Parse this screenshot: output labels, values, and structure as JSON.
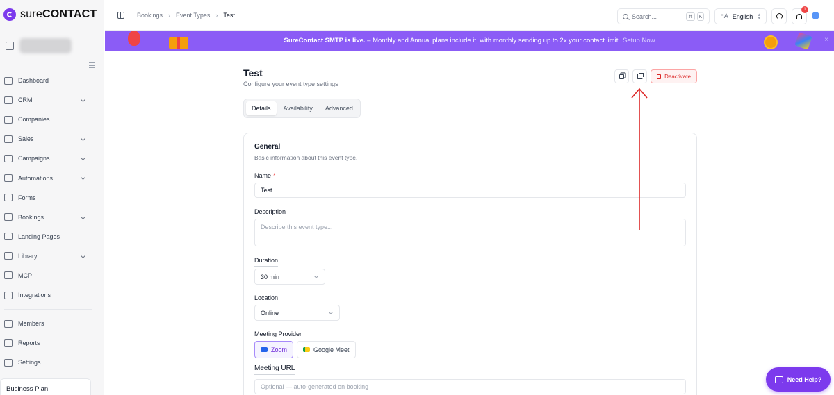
{
  "app": {
    "logo_text": "sureCONTACT",
    "logo_prefix": "sure",
    "logo_suffix": "CONTACT",
    "accent": "#7c3aed"
  },
  "sidebar": {
    "items": [
      {
        "label": "Dashboard",
        "icon": "dashboard-icon",
        "has_chevron": false
      },
      {
        "label": "CRM",
        "icon": "crm-icon",
        "has_chevron": true
      },
      {
        "label": "Companies",
        "icon": "companies-icon",
        "has_chevron": false
      },
      {
        "label": "Sales",
        "icon": "sales-icon",
        "has_chevron": true
      },
      {
        "label": "Campaigns",
        "icon": "megaphone-icon",
        "has_chevron": true
      },
      {
        "label": "Automations",
        "icon": "automations-icon",
        "has_chevron": true
      },
      {
        "label": "Forms",
        "icon": "forms-icon",
        "has_chevron": false
      },
      {
        "label": "Bookings",
        "icon": "calendar-icon",
        "has_chevron": true
      },
      {
        "label": "Landing Pages",
        "icon": "landing-pages-icon",
        "has_chevron": false
      },
      {
        "label": "Library",
        "icon": "library-icon",
        "has_chevron": true
      },
      {
        "label": "MCP",
        "icon": "mcp-icon",
        "has_chevron": false
      },
      {
        "label": "Integrations",
        "icon": "integrations-icon",
        "has_chevron": false
      }
    ],
    "bottom_items": [
      {
        "label": "Members",
        "icon": "members-icon"
      },
      {
        "label": "Reports",
        "icon": "reports-icon"
      },
      {
        "label": "Settings",
        "icon": "settings-icon"
      }
    ],
    "plan": "Business Plan"
  },
  "topbar": {
    "breadcrumb": [
      "Bookings",
      "Event Types",
      "Test"
    ],
    "search_placeholder": "Search...",
    "kbd_cmd": "⌘",
    "kbd_key": "K",
    "language": "English",
    "notification_count": "1"
  },
  "banner": {
    "bold": "SureContact SMTP is live.",
    "text": " – Monthly and Annual plans include it, with monthly sending up to 2x your contact limit.",
    "link": "Setup Now",
    "color": "#8b5cf6"
  },
  "page": {
    "title": "Test",
    "subtitle": "Configure your event type settings",
    "deactivate_label": "Deactivate",
    "tabs": [
      "Details",
      "Availability",
      "Advanced"
    ],
    "active_tab": "Details"
  },
  "form": {
    "section_title": "General",
    "section_desc": "Basic information about this event type.",
    "name_label": "Name",
    "name_required": "*",
    "name_value": "Test",
    "description_label": "Description",
    "description_placeholder": "Describe this event type...",
    "duration_label": "Duration",
    "duration_value": "30 min",
    "location_label": "Location",
    "location_value": "Online",
    "provider_label": "Meeting Provider",
    "providers": [
      {
        "label": "Zoom",
        "icon": "zoom-icon",
        "selected": true
      },
      {
        "label": "Google Meet",
        "icon": "google-meet-icon",
        "selected": false
      }
    ],
    "meeting_url_label": "Meeting URL",
    "meeting_url_placeholder": "Optional — auto-generated on booking"
  },
  "help": {
    "label": "Need Help?"
  },
  "annotation": {
    "color": "#dc2626"
  }
}
